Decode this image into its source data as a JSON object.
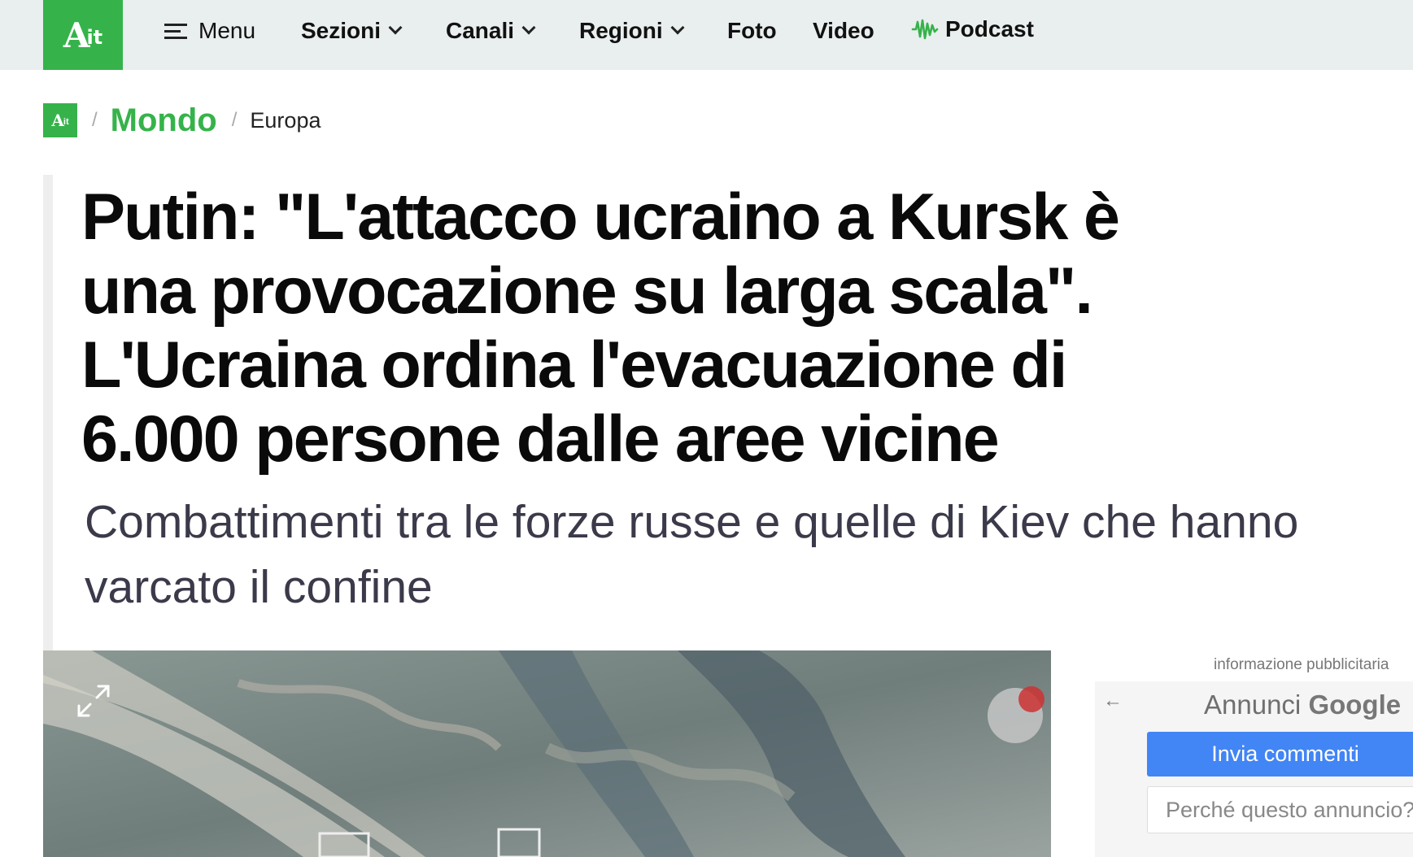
{
  "logo": {
    "text": "A",
    "suffix": "it"
  },
  "nav": {
    "menu_label": "Menu",
    "items": [
      {
        "label": "Sezioni"
      },
      {
        "label": "Canali"
      },
      {
        "label": "Regioni"
      },
      {
        "label": "Foto"
      },
      {
        "label": "Video"
      },
      {
        "label": "Podcast"
      }
    ]
  },
  "breadcrumb": {
    "separator": "/",
    "section": "Mondo",
    "subsection": "Europa"
  },
  "article": {
    "headline": "Putin: \"L'attacco ucraino a Kursk è una provocazione su larga scala\". L'Ucraina ordina l'evacuazione di 6.000 persone dalle aree vicine",
    "subheadline": "Combattimenti tra le forze russe e quelle di Kiev che hanno varcato il confine"
  },
  "ad": {
    "info": "informazione pubblicitaria",
    "title_prefix": "Annunci",
    "title_brand": "Google",
    "feedback_button": "Invia commenti",
    "why_button": "Perché questo annuncio?"
  },
  "colors": {
    "brand_green": "#35b34a",
    "topbar_bg": "#e9eeee",
    "ad_button_blue": "#4285f4"
  }
}
